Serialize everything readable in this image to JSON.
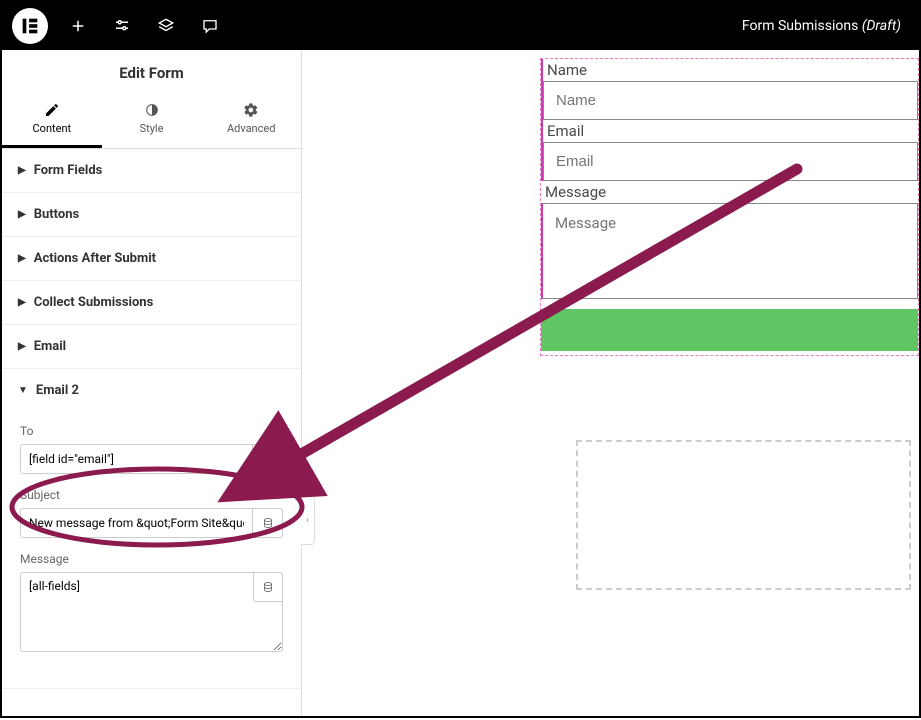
{
  "topbar": {
    "title": "Form Submissions",
    "suffix": "(Draft)"
  },
  "sidebar": {
    "title": "Edit Form",
    "tabs": {
      "content": "Content",
      "style": "Style",
      "advanced": "Advanced"
    },
    "sections": {
      "form_fields": "Form Fields",
      "buttons": "Buttons",
      "actions": "Actions After Submit",
      "collect": "Collect Submissions",
      "email": "Email",
      "email2": "Email 2"
    },
    "email2": {
      "to_label": "To",
      "to_value": "[field id=\"email\"]",
      "subject_label": "Subject",
      "subject_value": "New message from &quot;Form Site&quo",
      "message_label": "Message",
      "message_value": "[all-fields]"
    }
  },
  "form": {
    "name_label": "Name",
    "name_placeholder": "Name",
    "email_label": "Email",
    "email_placeholder": "Email",
    "message_label": "Message",
    "message_placeholder": "Message"
  }
}
